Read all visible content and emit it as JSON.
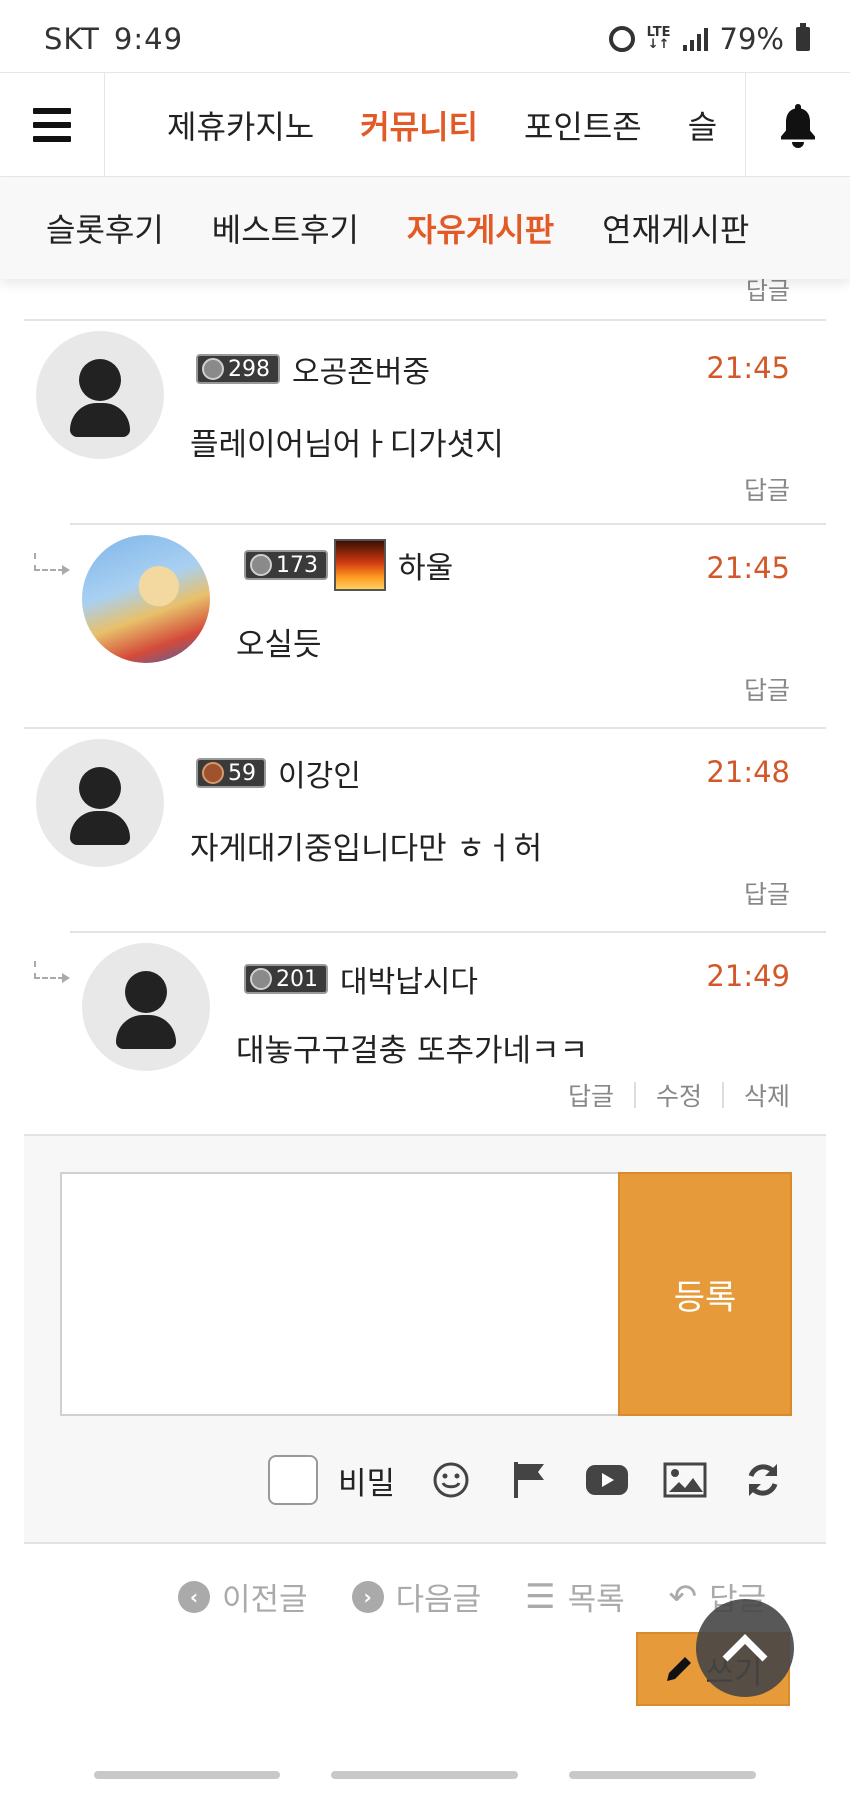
{
  "status_bar": {
    "carrier": "SKT",
    "time": "9:49",
    "network": "LTE",
    "battery": "79%"
  },
  "main_nav": {
    "items": [
      {
        "label": "제휴카지노",
        "active": false
      },
      {
        "label": "커뮤니티",
        "active": true
      },
      {
        "label": "포인트존",
        "active": false
      },
      {
        "label": "슬",
        "active": false
      }
    ]
  },
  "sub_nav": {
    "items": [
      {
        "label": "슬롯후기",
        "active": false
      },
      {
        "label": "베스트후기",
        "active": false
      },
      {
        "label": "자유게시판",
        "active": true
      },
      {
        "label": "연재게시판",
        "active": false
      }
    ]
  },
  "top_reply_label": "답글",
  "comments": [
    {
      "level": "298",
      "nickname": "오공존버중",
      "time": "21:45",
      "text": "플레이어님어ㅏ디가셧지",
      "reply_label": "답글"
    },
    {
      "level": "173",
      "nickname": "하울",
      "time": "21:45",
      "text": "오실듯",
      "reply_label": "답글"
    },
    {
      "level": "59",
      "nickname": "이강인",
      "time": "21:48",
      "text": "자게대기중입니다만 ㅎㅓ허",
      "reply_label": "답글"
    },
    {
      "level": "201",
      "nickname": "대박납시다",
      "time": "21:49",
      "text": "대놓구구걸충 또추가네ㅋㅋ",
      "reply_label": "답글",
      "edit_label": "수정",
      "delete_label": "삭제"
    }
  ],
  "write_box": {
    "submit_label": "등록",
    "secret_label": "비밀"
  },
  "bottom_nav": {
    "prev_label": "이전글",
    "next_label": "다음글",
    "list_label": "목록",
    "reply_label": "답글",
    "write_label": "쓰기"
  },
  "colors": {
    "accent": "#e25a26",
    "time": "#d2582a",
    "button": "#e69a3a"
  }
}
